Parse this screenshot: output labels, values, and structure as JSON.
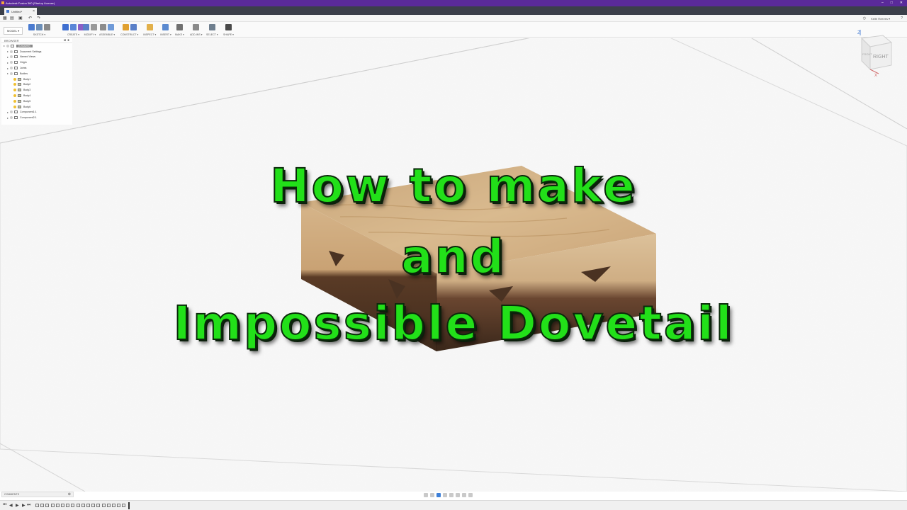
{
  "app": {
    "title": "Autodesk Fusion 360 (Startup License)",
    "window_controls": [
      "–",
      "□",
      "✕"
    ]
  },
  "document_tab": {
    "label": "Untitled*"
  },
  "quick_access": {
    "user": "Keith Reeves ▾",
    "help": "?",
    "clock": "◷"
  },
  "ribbon": {
    "workspace": "MODEL ▾",
    "groups": [
      {
        "label": "SKETCH ▾",
        "colors": [
          "#4a7bd0",
          "#6c8fb8",
          "#8a8a8a"
        ]
      },
      {
        "label": "CREATE ▾",
        "colors": [
          "#3f6fd0",
          "#5a86d8",
          "#8b5fc7"
        ]
      },
      {
        "label": "MODIFY ▾",
        "colors": [
          "#5a7fc8",
          "#9a9a9a"
        ]
      },
      {
        "label": "ASSEMBLE ▾",
        "colors": [
          "#8c8c8c",
          "#6f9ad8"
        ]
      },
      {
        "label": "CONSTRUCT ▾",
        "colors": [
          "#e0a030",
          "#5a7fc8"
        ]
      },
      {
        "label": "INSPECT ▾",
        "colors": [
          "#e2b04a"
        ]
      },
      {
        "label": "INSERT ▾",
        "colors": [
          "#5b8ad0"
        ]
      },
      {
        "label": "MAKE ▾",
        "colors": [
          "#707070"
        ]
      },
      {
        "label": "ADD-INS ▾",
        "colors": [
          "#8a8a8a"
        ]
      },
      {
        "label": "SELECT ▾",
        "colors": [
          "#6f7f8f"
        ]
      },
      {
        "label": "SHAPE ▾",
        "colors": [
          "#4a4a4a"
        ]
      }
    ]
  },
  "browser": {
    "header": "BROWSER",
    "controls": "◄ ●",
    "nodes": [
      {
        "label": "(Unsaved)",
        "level": 0,
        "root": true
      },
      {
        "label": "Document Settings",
        "level": 1
      },
      {
        "label": "Named Views",
        "level": 1
      },
      {
        "label": "Origin",
        "level": 1
      },
      {
        "label": "Joints",
        "level": 1
      },
      {
        "label": "Bodies",
        "level": 1
      },
      {
        "label": "Body1",
        "level": 2
      },
      {
        "label": "Body2",
        "level": 2
      },
      {
        "label": "Body3",
        "level": 2
      },
      {
        "label": "Body4",
        "level": 2
      },
      {
        "label": "Body5",
        "level": 2
      },
      {
        "label": "Body6",
        "level": 2
      },
      {
        "label": "Component1:1",
        "level": 1
      },
      {
        "label": "Component2:1",
        "level": 1
      }
    ]
  },
  "viewcube": {
    "front": "FRONT",
    "right": "RIGHT",
    "axis_z": "Z",
    "axis_x": "X"
  },
  "headline": {
    "line1": "How to make",
    "line2": "and",
    "line3": "Impossible Dovetail"
  },
  "comments": {
    "label": "COMMENTS",
    "control": "⊕"
  },
  "colors": {
    "title_bar": "#5a2a9a",
    "headline": "#22e019",
    "wood_light": "#d4b48a",
    "wood_dark": "#4a3222"
  }
}
